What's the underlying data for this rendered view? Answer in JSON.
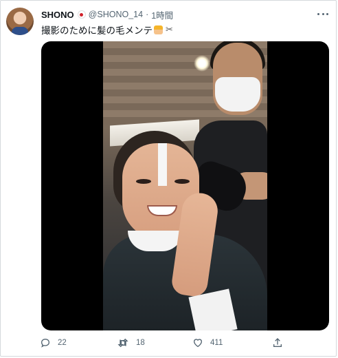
{
  "tweet": {
    "author_name": "SHONO",
    "flag_emoji": "🇯🇵",
    "handle": "@SHONO_14",
    "separator": "·",
    "time": "1時間",
    "text": "撮影のために髪の毛メンテ",
    "emojis": [
      "hairdresser-icon",
      "scissors-icon"
    ]
  },
  "media": {
    "type": "video"
  },
  "actions": {
    "reply_count": "22",
    "retweet_count": "18",
    "like_count": "411"
  },
  "colors": {
    "text": "#0f1419",
    "secondary": "#536471",
    "border": "#d4d8dc"
  }
}
